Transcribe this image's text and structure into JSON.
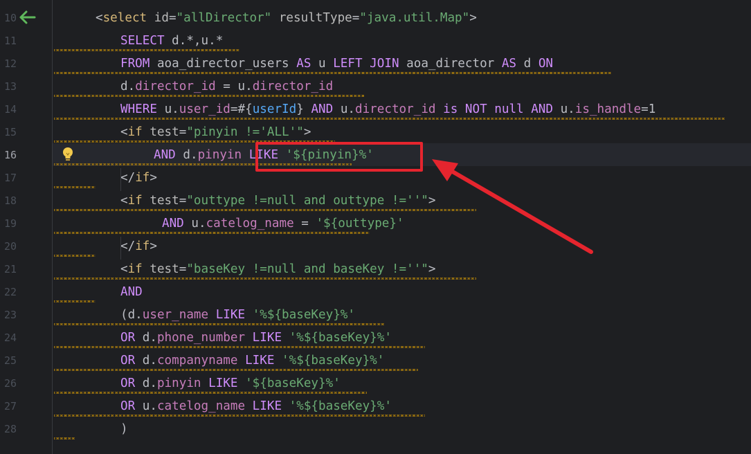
{
  "editor": {
    "active_line": 16,
    "lines": [
      {
        "num": "10",
        "tokens": [
          {
            "t": "<",
            "c": "tok-sym"
          },
          {
            "t": "select",
            "c": "tok-tag"
          },
          {
            "t": " ",
            "c": "tok-sym"
          },
          {
            "t": "id",
            "c": "tok-attr"
          },
          {
            "t": "=",
            "c": "tok-sym"
          },
          {
            "t": "\"allDirector\"",
            "c": "tok-str"
          },
          {
            "t": " ",
            "c": "tok-sym"
          },
          {
            "t": "resultType",
            "c": "tok-attr"
          },
          {
            "t": "=",
            "c": "tok-sym"
          },
          {
            "t": "\"java.util.Map\"",
            "c": "tok-str"
          },
          {
            "t": ">",
            "c": "tok-sym"
          }
        ]
      },
      {
        "num": "11",
        "tokens": [
          {
            "t": "SELECT ",
            "c": "tok-kw"
          },
          {
            "t": "d.*,u.*",
            "c": "tok-id"
          }
        ]
      },
      {
        "num": "12",
        "tokens": [
          {
            "t": "FROM ",
            "c": "tok-kw"
          },
          {
            "t": "aoa_director_users ",
            "c": "tok-id"
          },
          {
            "t": "AS ",
            "c": "tok-kw"
          },
          {
            "t": "u ",
            "c": "tok-id"
          },
          {
            "t": "LEFT JOIN ",
            "c": "tok-kw"
          },
          {
            "t": "aoa_director ",
            "c": "tok-id"
          },
          {
            "t": "AS ",
            "c": "tok-kw"
          },
          {
            "t": "d ",
            "c": "tok-id"
          },
          {
            "t": "ON",
            "c": "tok-kw"
          }
        ]
      },
      {
        "num": "13",
        "tokens": [
          {
            "t": "d.",
            "c": "tok-id"
          },
          {
            "t": "director_id",
            "c": "tok-col"
          },
          {
            "t": " = ",
            "c": "tok-sym"
          },
          {
            "t": "u.",
            "c": "tok-id"
          },
          {
            "t": "director_id",
            "c": "tok-col"
          }
        ]
      },
      {
        "num": "14",
        "tokens": [
          {
            "t": "WHERE ",
            "c": "tok-kw"
          },
          {
            "t": "u.",
            "c": "tok-id"
          },
          {
            "t": "user_id",
            "c": "tok-col"
          },
          {
            "t": "=#{",
            "c": "tok-sym"
          },
          {
            "t": "userId",
            "c": "tok-param"
          },
          {
            "t": "} ",
            "c": "tok-sym"
          },
          {
            "t": "AND ",
            "c": "tok-kw"
          },
          {
            "t": "u.",
            "c": "tok-id"
          },
          {
            "t": "director_id ",
            "c": "tok-col"
          },
          {
            "t": "is NOT null AND ",
            "c": "tok-kw"
          },
          {
            "t": "u.",
            "c": "tok-id"
          },
          {
            "t": "is_handle",
            "c": "tok-col"
          },
          {
            "t": "=1",
            "c": "tok-sym"
          }
        ]
      },
      {
        "num": "15",
        "tokens": [
          {
            "t": "<",
            "c": "tok-sym"
          },
          {
            "t": "if",
            "c": "tok-tag"
          },
          {
            "t": " ",
            "c": "tok-sym"
          },
          {
            "t": "test",
            "c": "tok-attr"
          },
          {
            "t": "=",
            "c": "tok-sym"
          },
          {
            "t": "\"pinyin !='ALL'\"",
            "c": "tok-str"
          },
          {
            "t": ">",
            "c": "tok-sym"
          }
        ]
      },
      {
        "num": "16",
        "tokens": [
          {
            "t": "AND ",
            "c": "tok-kw"
          },
          {
            "t": "d.",
            "c": "tok-id"
          },
          {
            "t": "pinyin ",
            "c": "tok-col"
          },
          {
            "t": "LIKE ",
            "c": "tok-kw"
          },
          {
            "t": "'${pinyin}%'",
            "c": "tok-str"
          }
        ]
      },
      {
        "num": "17",
        "tokens": [
          {
            "t": "</",
            "c": "tok-sym"
          },
          {
            "t": "if",
            "c": "tok-tag"
          },
          {
            "t": ">",
            "c": "tok-sym"
          }
        ]
      },
      {
        "num": "18",
        "tokens": [
          {
            "t": "<",
            "c": "tok-sym"
          },
          {
            "t": "if",
            "c": "tok-tag"
          },
          {
            "t": " ",
            "c": "tok-sym"
          },
          {
            "t": "test",
            "c": "tok-attr"
          },
          {
            "t": "=",
            "c": "tok-sym"
          },
          {
            "t": "\"outtype !=null and outtype !=''\"",
            "c": "tok-str"
          },
          {
            "t": ">",
            "c": "tok-sym"
          }
        ]
      },
      {
        "num": "19",
        "tokens": [
          {
            "t": "AND ",
            "c": "tok-kw"
          },
          {
            "t": "u.",
            "c": "tok-id"
          },
          {
            "t": "catelog_name",
            "c": "tok-col"
          },
          {
            "t": " = ",
            "c": "tok-sym"
          },
          {
            "t": "'${outtype}'",
            "c": "tok-str"
          }
        ]
      },
      {
        "num": "20",
        "tokens": [
          {
            "t": "</",
            "c": "tok-sym"
          },
          {
            "t": "if",
            "c": "tok-tag"
          },
          {
            "t": ">",
            "c": "tok-sym"
          }
        ]
      },
      {
        "num": "21",
        "tokens": [
          {
            "t": "<",
            "c": "tok-sym"
          },
          {
            "t": "if",
            "c": "tok-tag"
          },
          {
            "t": " ",
            "c": "tok-sym"
          },
          {
            "t": "test",
            "c": "tok-attr"
          },
          {
            "t": "=",
            "c": "tok-sym"
          },
          {
            "t": "\"baseKey !=null and baseKey !=''\"",
            "c": "tok-str"
          },
          {
            "t": ">",
            "c": "tok-sym"
          }
        ]
      },
      {
        "num": "22",
        "tokens": [
          {
            "t": "AND",
            "c": "tok-kw"
          }
        ]
      },
      {
        "num": "23",
        "tokens": [
          {
            "t": "(d.",
            "c": "tok-id"
          },
          {
            "t": "user_name ",
            "c": "tok-col"
          },
          {
            "t": "LIKE ",
            "c": "tok-kw"
          },
          {
            "t": "'%${baseKey}%'",
            "c": "tok-str"
          }
        ]
      },
      {
        "num": "24",
        "tokens": [
          {
            "t": "OR ",
            "c": "tok-kw"
          },
          {
            "t": "d.",
            "c": "tok-id"
          },
          {
            "t": "phone_number ",
            "c": "tok-col"
          },
          {
            "t": "LIKE ",
            "c": "tok-kw"
          },
          {
            "t": "'%${baseKey}%'",
            "c": "tok-str"
          }
        ]
      },
      {
        "num": "25",
        "tokens": [
          {
            "t": "OR ",
            "c": "tok-kw"
          },
          {
            "t": "d.",
            "c": "tok-id"
          },
          {
            "t": "companyname ",
            "c": "tok-col"
          },
          {
            "t": "LIKE ",
            "c": "tok-kw"
          },
          {
            "t": "'%${baseKey}%'",
            "c": "tok-str"
          }
        ]
      },
      {
        "num": "26",
        "tokens": [
          {
            "t": "OR ",
            "c": "tok-kw"
          },
          {
            "t": "d.",
            "c": "tok-id"
          },
          {
            "t": "pinyin ",
            "c": "tok-col"
          },
          {
            "t": "LIKE ",
            "c": "tok-kw"
          },
          {
            "t": "'${baseKey}%'",
            "c": "tok-str"
          }
        ]
      },
      {
        "num": "27",
        "tokens": [
          {
            "t": "OR ",
            "c": "tok-kw"
          },
          {
            "t": "u.",
            "c": "tok-id"
          },
          {
            "t": "catelog_name ",
            "c": "tok-col"
          },
          {
            "t": "LIKE ",
            "c": "tok-kw"
          },
          {
            "t": "'%${baseKey}%'",
            "c": "tok-str"
          }
        ]
      },
      {
        "num": "28",
        "tokens": [
          {
            "t": ")",
            "c": "tok-sym"
          }
        ]
      }
    ]
  },
  "colors": {
    "background": "#1e1f22",
    "tag": "#d5b778",
    "string": "#6aab73",
    "keyword": "#cf8dfb",
    "highlight_box": "#e5252e",
    "arrow": "#e5252e"
  },
  "icons": {
    "back": "back-arrow-icon",
    "intention": "lightbulb-icon"
  }
}
